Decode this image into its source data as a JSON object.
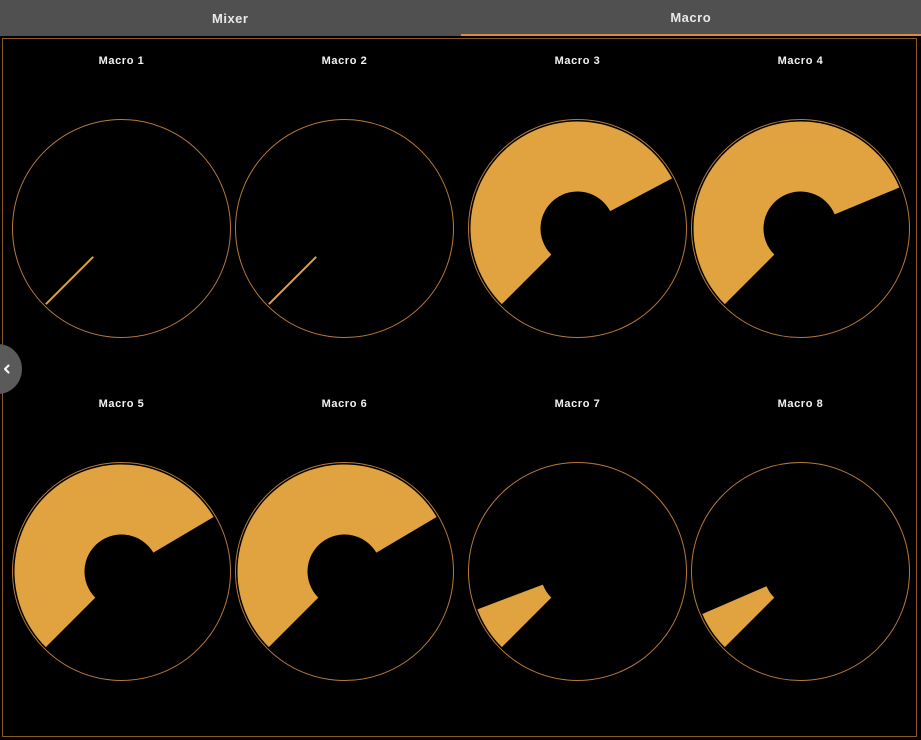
{
  "tabs": [
    {
      "label": "Mixer",
      "active": false
    },
    {
      "label": "Macro",
      "active": true
    }
  ],
  "colors": {
    "accent": "#e0a340",
    "ring": "#b87a3a",
    "tab_underline": "#e08a3c",
    "tabbar_bg": "#505050",
    "panel_bg": "#000000"
  },
  "side_handle_icon": "chevron-left-icon",
  "macros": [
    {
      "label": "Macro 1",
      "value": 0.0
    },
    {
      "label": "Macro 2",
      "value": 0.0
    },
    {
      "label": "Macro 3",
      "value": 0.73
    },
    {
      "label": "Macro 4",
      "value": 0.75
    },
    {
      "label": "Macro 5",
      "value": 0.72
    },
    {
      "label": "Macro 6",
      "value": 0.72
    },
    {
      "label": "Macro 7",
      "value": 0.09
    },
    {
      "label": "Macro 8",
      "value": 0.08
    }
  ]
}
